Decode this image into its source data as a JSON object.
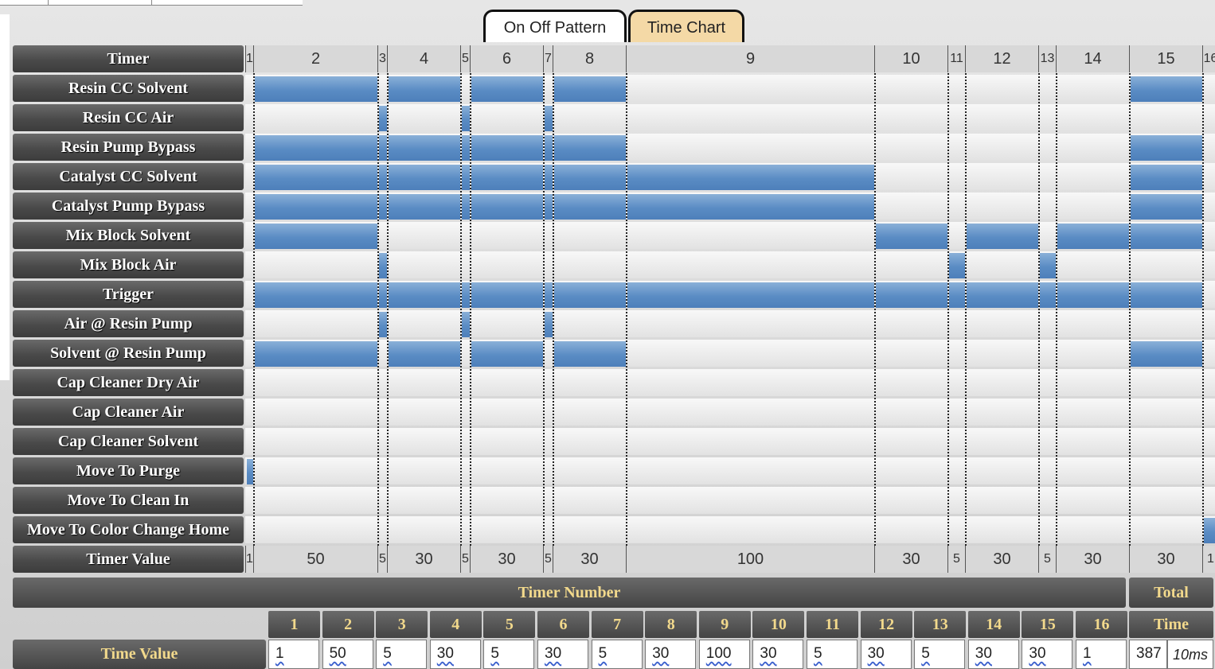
{
  "tabs": {
    "on_off_pattern": "On Off Pattern",
    "time_chart": "Time Chart"
  },
  "timer_label": "Timer",
  "timer_value_label": "Timer Value",
  "segments": [
    {
      "id": "1",
      "value": "1",
      "w": 1
    },
    {
      "id": "2",
      "value": "50",
      "w": 50
    },
    {
      "id": "3",
      "value": "5",
      "w": 5
    },
    {
      "id": "4",
      "value": "30",
      "w": 30
    },
    {
      "id": "5",
      "value": "5",
      "w": 5
    },
    {
      "id": "6",
      "value": "30",
      "w": 30
    },
    {
      "id": "7",
      "value": "5",
      "w": 5
    },
    {
      "id": "8",
      "value": "30",
      "w": 30
    },
    {
      "id": "9",
      "value": "100",
      "w": 100
    },
    {
      "id": "10",
      "value": "30",
      "w": 30
    },
    {
      "id": "11",
      "value": "5",
      "w": 5
    },
    {
      "id": "12",
      "value": "30",
      "w": 30
    },
    {
      "id": "13",
      "value": "5",
      "w": 5
    },
    {
      "id": "14",
      "value": "30",
      "w": 30
    },
    {
      "id": "15",
      "value": "30",
      "w": 30
    },
    {
      "id": "16",
      "value": "1",
      "w": 1
    }
  ],
  "channels": [
    {
      "label": "Resin CC Solvent",
      "on": [
        1,
        3,
        5,
        7,
        14
      ]
    },
    {
      "label": "Resin CC Air",
      "on": [
        2,
        4,
        6
      ]
    },
    {
      "label": "Resin Pump Bypass",
      "on": [
        1,
        2,
        3,
        4,
        5,
        6,
        7,
        14
      ]
    },
    {
      "label": "Catalyst CC Solvent",
      "on": [
        1,
        2,
        3,
        4,
        5,
        6,
        7,
        8,
        14
      ]
    },
    {
      "label": "Catalyst Pump Bypass",
      "on": [
        1,
        2,
        3,
        4,
        5,
        6,
        7,
        8,
        14
      ]
    },
    {
      "label": "Mix Block Solvent",
      "on": [
        1,
        9,
        11,
        13,
        14
      ]
    },
    {
      "label": "Mix Block Air",
      "on": [
        2,
        10,
        12
      ]
    },
    {
      "label": "Trigger",
      "on": [
        1,
        2,
        3,
        4,
        5,
        6,
        7,
        8,
        9,
        10,
        11,
        12,
        13,
        14
      ]
    },
    {
      "label": "Air @ Resin Pump",
      "on": [
        2,
        4,
        6
      ]
    },
    {
      "label": "Solvent @ Resin Pump",
      "on": [
        1,
        3,
        5,
        7,
        14
      ]
    },
    {
      "label": "Cap Cleaner Dry Air",
      "on": []
    },
    {
      "label": "Cap Cleaner Air",
      "on": []
    },
    {
      "label": "Cap Cleaner Solvent",
      "on": []
    },
    {
      "label": "Move To Purge",
      "on": [
        0
      ]
    },
    {
      "label": "Move To Clean In",
      "on": []
    },
    {
      "label": "Move To Color Change Home",
      "on": [
        15
      ]
    }
  ],
  "bottom": {
    "timer_number": "Timer Number",
    "total": "Total",
    "time": "Time",
    "time_value_label": "Time Value",
    "numbers": [
      "1",
      "2",
      "3",
      "4",
      "5",
      "6",
      "7",
      "8",
      "9",
      "10",
      "11",
      "12",
      "13",
      "14",
      "15",
      "16"
    ],
    "values": [
      "1",
      "50",
      "5",
      "30",
      "5",
      "30",
      "5",
      "30",
      "100",
      "30",
      "5",
      "30",
      "5",
      "30",
      "30",
      "1"
    ],
    "total_value": "387",
    "total_unit": "10ms"
  }
}
